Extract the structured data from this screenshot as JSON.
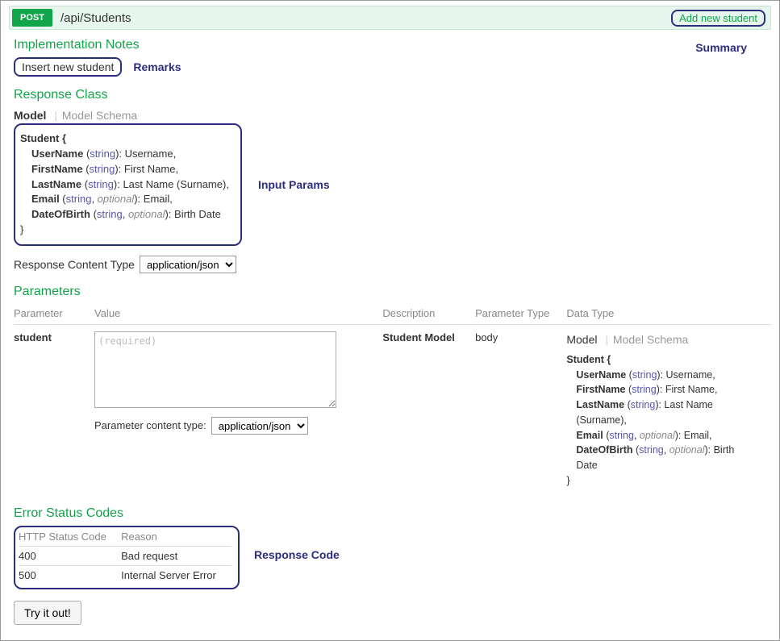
{
  "operation": {
    "method": "POST",
    "path": "/api/Students",
    "summary": "Add new student"
  },
  "annotations": {
    "summary": "Summary",
    "remarks": "Remarks",
    "input_params": "Input Params",
    "response_code": "Response Code"
  },
  "sections": {
    "impl_notes": "Implementation Notes",
    "impl_notes_text": "Insert new student",
    "response_class": "Response Class",
    "parameters": "Parameters",
    "error_status_codes": "Error Status Codes"
  },
  "tabs": {
    "model": "Model",
    "model_schema": "Model Schema"
  },
  "model": {
    "name": "Student",
    "open": "Student {",
    "close": "}",
    "props": [
      {
        "name": "UserName",
        "type": "string",
        "optional": false,
        "desc": "Username"
      },
      {
        "name": "FirstName",
        "type": "string",
        "optional": false,
        "desc": "First Name"
      },
      {
        "name": "LastName",
        "type": "string",
        "optional": false,
        "desc": "Last Name (Surname)"
      },
      {
        "name": "Email",
        "type": "string",
        "optional": true,
        "desc": "Email"
      },
      {
        "name": "DateOfBirth",
        "type": "string",
        "optional": true,
        "desc": "Birth Date"
      }
    ]
  },
  "response_content_type": {
    "label": "Response Content Type",
    "value": "application/json"
  },
  "params_table": {
    "headers": {
      "param": "Parameter",
      "value": "Value",
      "desc": "Description",
      "ptype": "Parameter Type",
      "dtype": "Data Type"
    },
    "rows": [
      {
        "name": "student",
        "value_placeholder": "(required)",
        "desc": "Student Model",
        "ptype": "body"
      }
    ],
    "param_content_type": {
      "label": "Parameter content type:",
      "value": "application/json"
    }
  },
  "errors": {
    "headers": {
      "code": "HTTP Status Code",
      "reason": "Reason"
    },
    "rows": [
      {
        "code": "400",
        "reason": "Bad request"
      },
      {
        "code": "500",
        "reason": "Internal Server Error"
      }
    ]
  },
  "buttons": {
    "try": "Try it out!"
  },
  "tokens": {
    "type_open": "(",
    "type_close": ")",
    "optional": "optional",
    "colon": ": ",
    "comma": ",",
    "sep": ", "
  }
}
